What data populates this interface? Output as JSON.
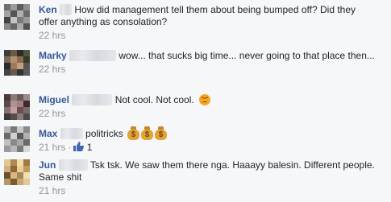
{
  "comments": [
    {
      "author": "Ken",
      "text": "How did management tell them about being bumped off? Did they offer anything as consolation?",
      "time": "22 hrs"
    },
    {
      "author": "Marky",
      "text": "wow... that sucks big time... never going to that place then...",
      "time": "22 hrs"
    },
    {
      "author": "Miguel",
      "text": "Not cool. Not cool.",
      "emoji": "angry-face-icon",
      "time": "22 hrs"
    },
    {
      "author": "Max",
      "text": "politricks",
      "emoji": "money-bag-icon",
      "time": "21 hrs",
      "like_count": "1"
    },
    {
      "author": "Jun",
      "text": "Tsk tsk. We saw them there nga. Haaayy balesin. Different people. Same shit",
      "time": "21 hrs"
    }
  ],
  "colors": {
    "author": "#365899",
    "meta": "#90949c",
    "background": "#f6f7f9",
    "like": "#4267b2"
  }
}
